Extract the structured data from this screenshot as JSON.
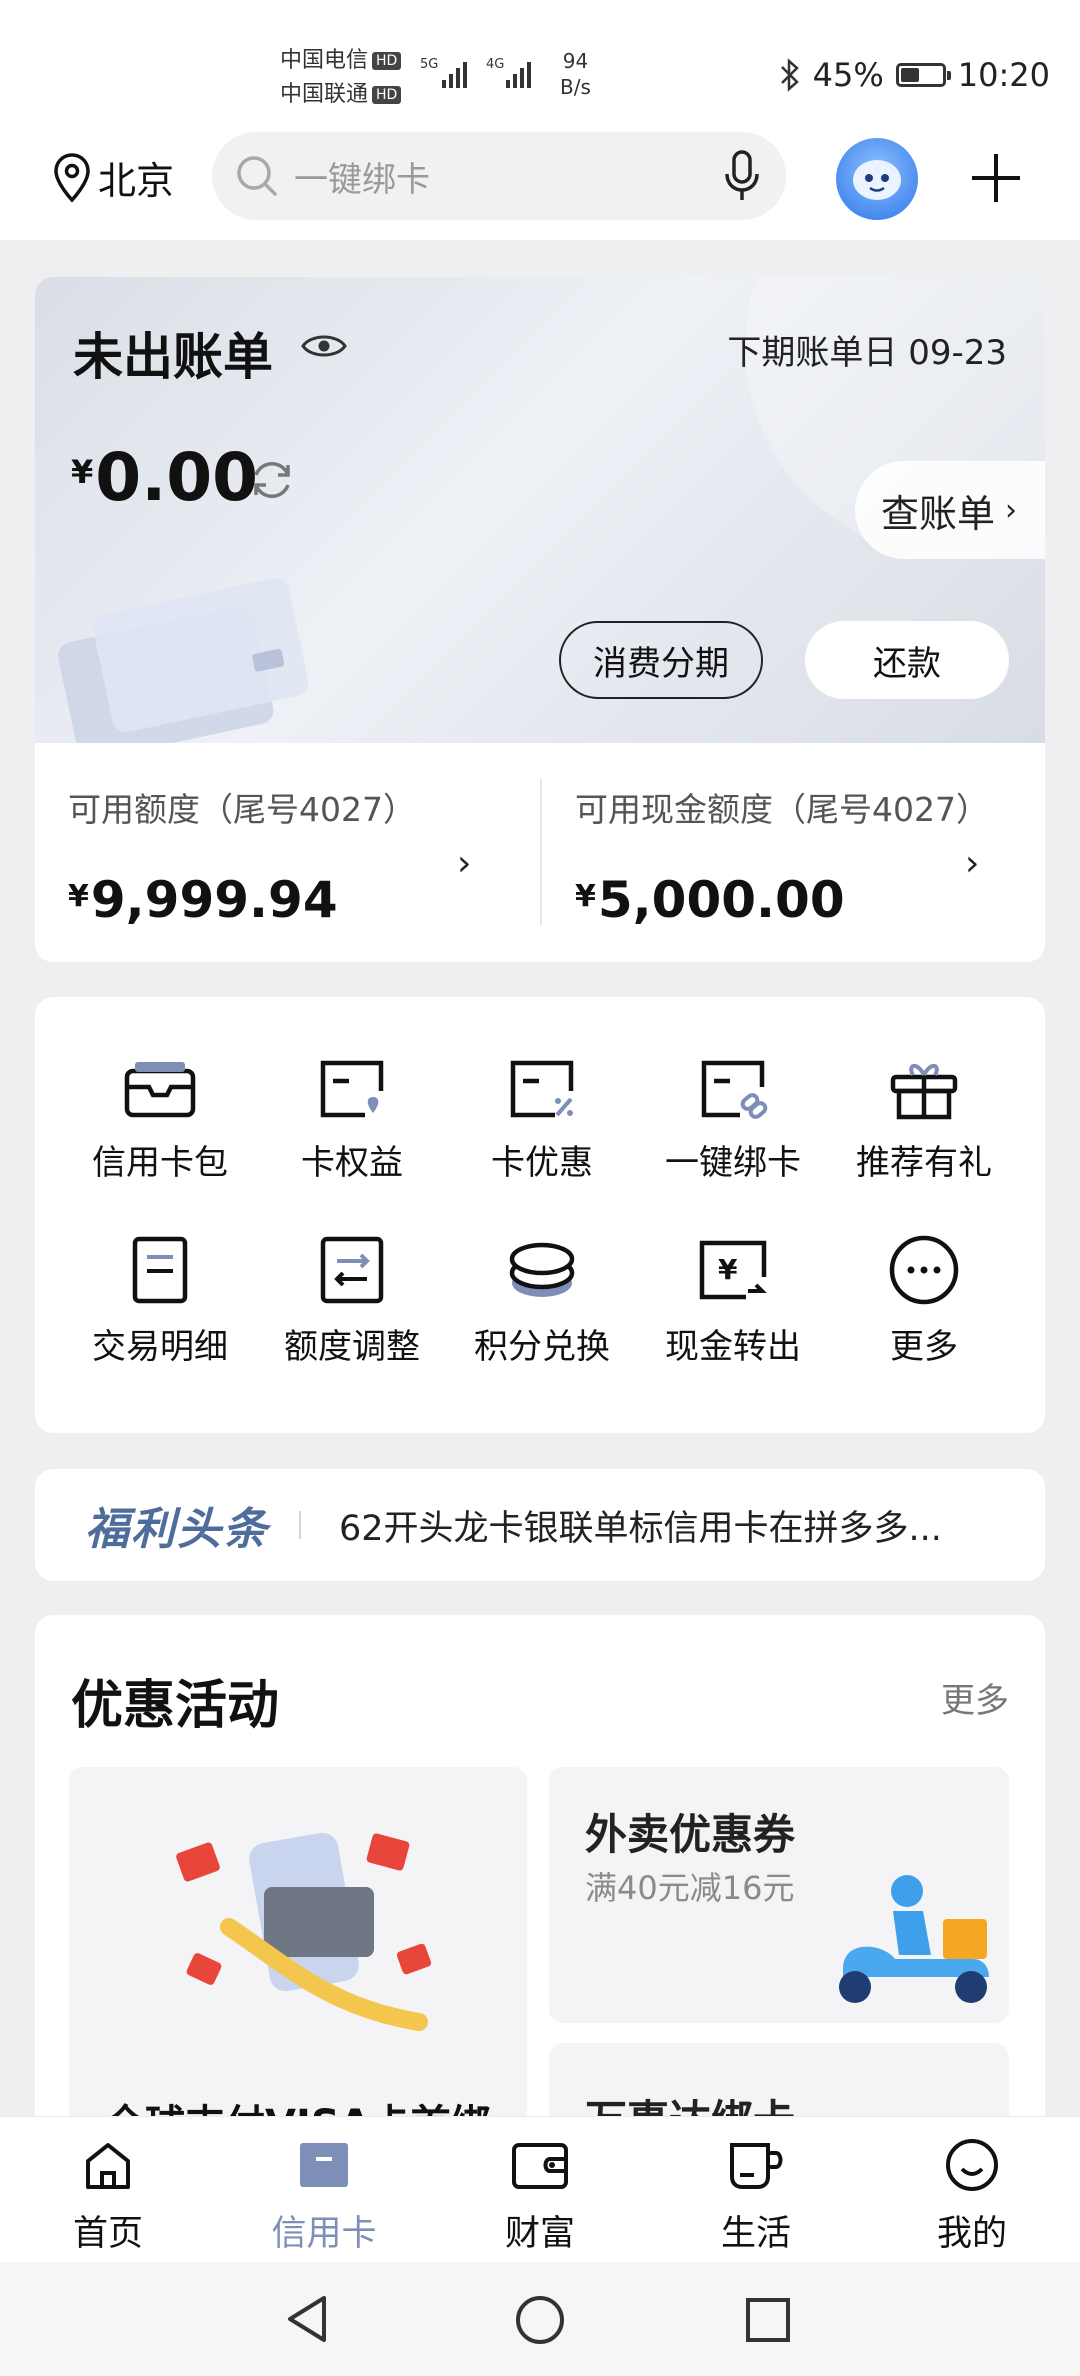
{
  "status_bar": {
    "carrier1": "中国电信",
    "carrier2": "中国联通",
    "hd_badge": "HD",
    "net1": "5G",
    "net2": "4G",
    "speed_value": "94",
    "speed_unit": "B/s",
    "battery": "45%",
    "battery_level": 0.45,
    "time": "10:20"
  },
  "header": {
    "location": "北京",
    "search_placeholder": "一键绑卡"
  },
  "bill": {
    "title": "未出账单",
    "next_bill_date": "下期账单日  09-23",
    "currency": "¥",
    "amount": "0.00",
    "check_bill_label": "查账单",
    "installment_label": "消费分期",
    "repay_label": "还款"
  },
  "quota": {
    "available_label": "可用额度（尾号4027）",
    "available_value": "9,999.94",
    "cash_label": "可用现金额度（尾号4027）",
    "cash_value": "5,000.00",
    "currency": "¥"
  },
  "shortcuts": [
    {
      "label": "信用卡包",
      "icon": "wallet-card-icon"
    },
    {
      "label": "卡权益",
      "icon": "card-benefit-icon"
    },
    {
      "label": "卡优惠",
      "icon": "card-discount-icon"
    },
    {
      "label": "一键绑卡",
      "icon": "card-link-icon"
    },
    {
      "label": "推荐有礼",
      "icon": "gift-icon"
    },
    {
      "label": "交易明细",
      "icon": "document-icon"
    },
    {
      "label": "额度调整",
      "icon": "adjust-icon"
    },
    {
      "label": "积分兑换",
      "icon": "coins-icon"
    },
    {
      "label": "现金转出",
      "icon": "cash-out-icon"
    },
    {
      "label": "更多",
      "icon": "more-icon"
    }
  ],
  "welfare": {
    "brand": "福利头条",
    "headline": "62开头龙卡银联单标信用卡在拼多多..."
  },
  "promotions": {
    "title": "优惠活动",
    "more_label": "更多",
    "card_left_title": "全球支付VISA卡首绑",
    "card_right1_title": "外卖优惠券",
    "card_right1_subtitle": "满40元减16元",
    "card_right2_title": "万事达绑卡"
  },
  "bottom_nav": [
    {
      "label": "首页",
      "icon": "home-icon",
      "active": false
    },
    {
      "label": "信用卡",
      "icon": "credit-card-icon",
      "active": true
    },
    {
      "label": "财富",
      "icon": "wallet-icon",
      "active": false
    },
    {
      "label": "生活",
      "icon": "cup-icon",
      "active": false
    },
    {
      "label": "我的",
      "icon": "smile-icon",
      "active": false
    }
  ],
  "colors": {
    "accent_active": "#7d8fb7",
    "welfare_brand": "#4f6d9c",
    "page_bg": "#efeff1"
  }
}
